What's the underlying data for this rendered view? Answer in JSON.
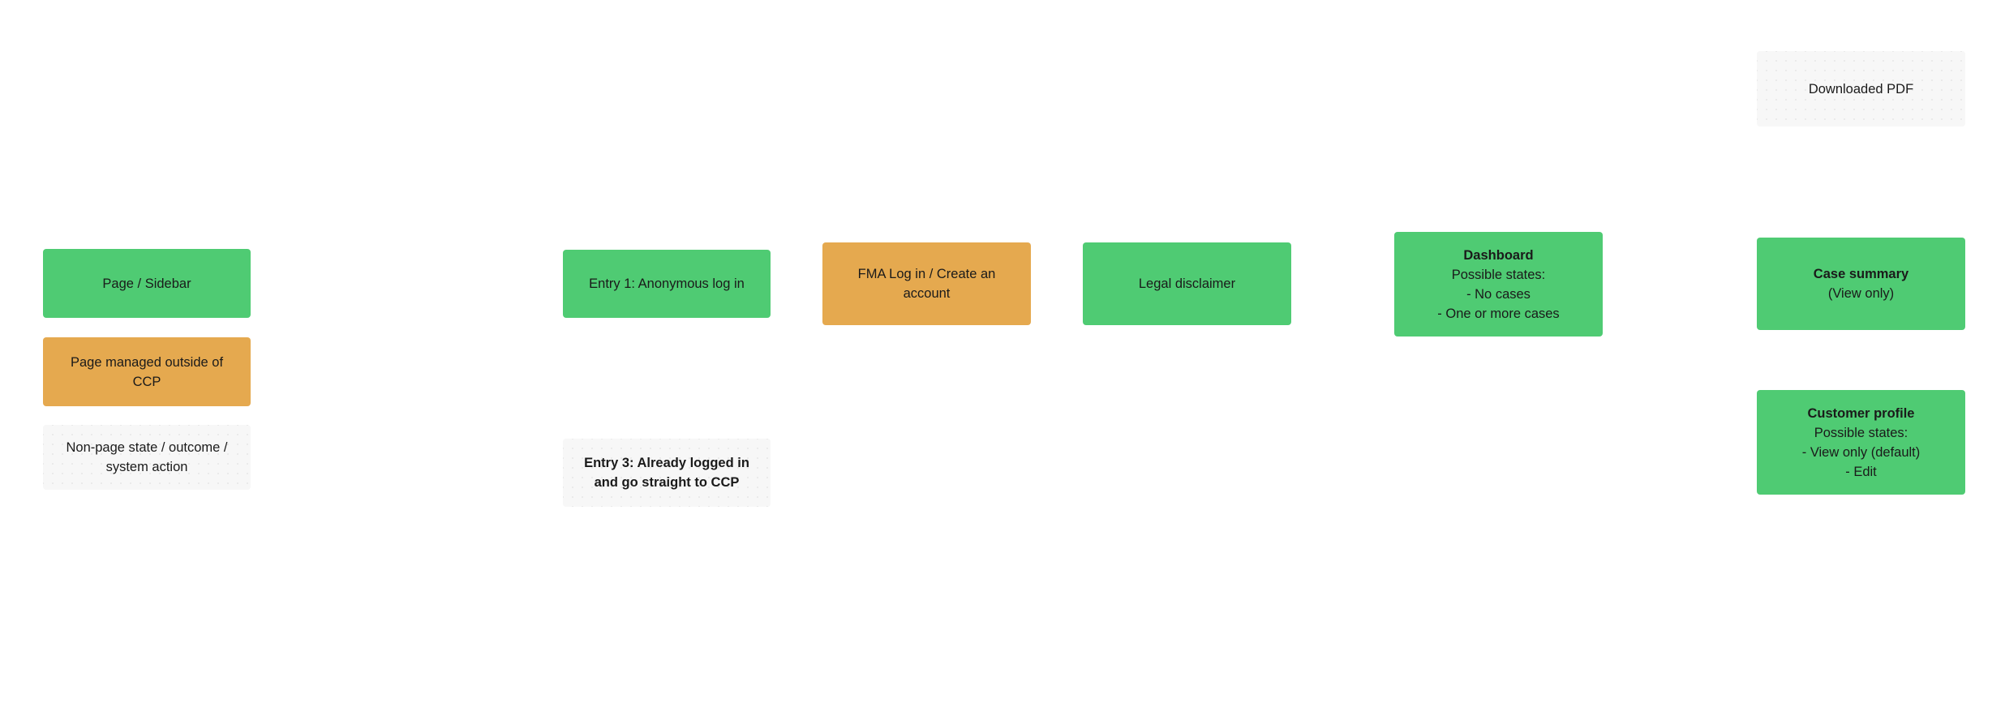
{
  "colors": {
    "page_node": "#4fcb73",
    "external_page_node": "#e5a94f",
    "non_page_node": "#f7f7f7",
    "text": "#1a1a1a"
  },
  "legend": {
    "page": "Page / Sidebar",
    "external_line1": "Page managed outside of",
    "external_line2": "CCP",
    "non_page_line1": "Non-page state / outcome /",
    "non_page_line2": "system action"
  },
  "nodes": {
    "entry1": "Entry 1: Anonymous log in",
    "entry3_line1": "Entry 3: Already logged in",
    "entry3_line2": "and go straight to CCP",
    "fma_line1": "FMA Log in / Create an",
    "fma_line2": "account",
    "legal": "Legal disclaimer",
    "dashboard": {
      "title": "Dashboard",
      "subtitle": "Possible states:",
      "states": [
        "- No cases",
        "- One or more cases"
      ]
    },
    "downloaded_pdf": "Downloaded PDF",
    "case_summary": {
      "title": "Case summary",
      "subtitle": "(View only)"
    },
    "customer_profile": {
      "title": "Customer profile",
      "subtitle": "Possible states:",
      "states": [
        "- View only (default)",
        "- Edit"
      ]
    }
  }
}
